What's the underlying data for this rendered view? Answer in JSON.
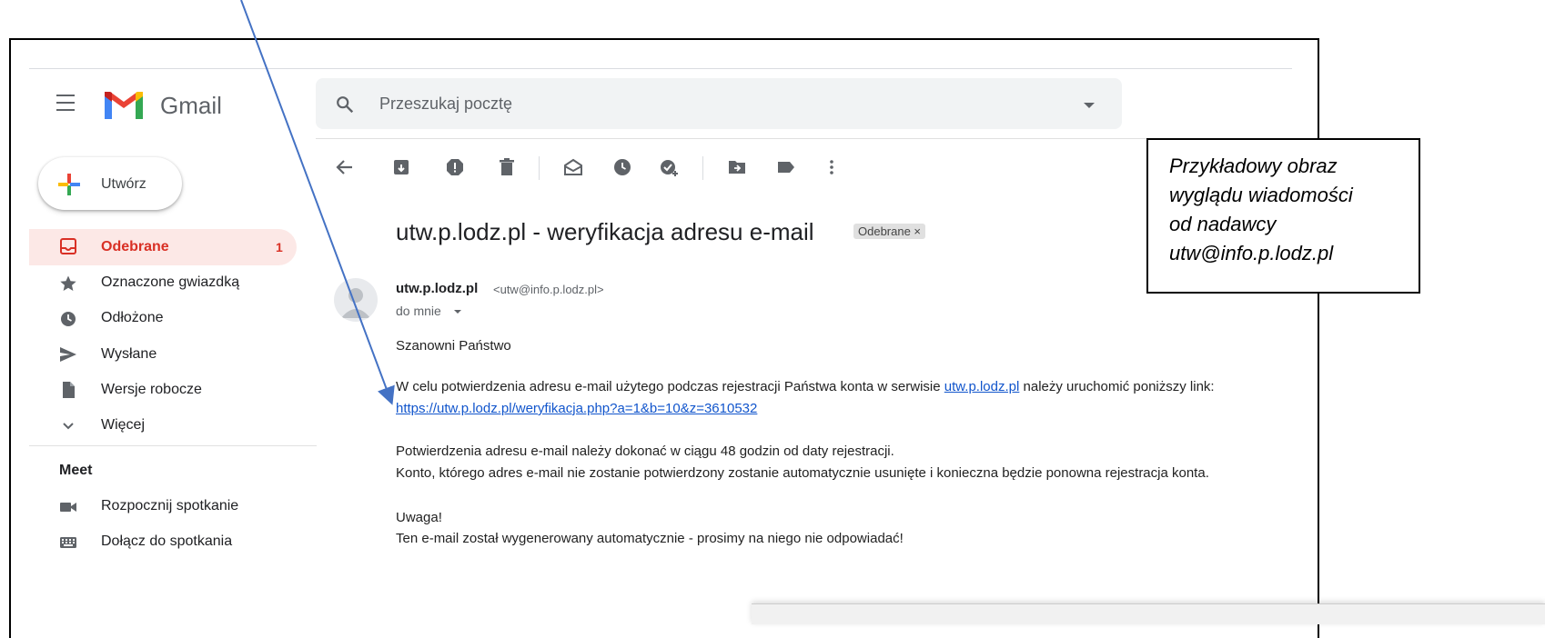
{
  "header": {
    "app_name": "Gmail",
    "search_placeholder": "Przeszukaj pocztę"
  },
  "compose": {
    "label": "Utwórz"
  },
  "sidebar": {
    "items": [
      {
        "label": "Odebrane",
        "count": "1",
        "icon": "inbox-icon"
      },
      {
        "label": "Oznaczone gwiazdką",
        "icon": "star-icon"
      },
      {
        "label": "Odłożone",
        "icon": "clock-icon"
      },
      {
        "label": "Wysłane",
        "icon": "send-icon"
      },
      {
        "label": "Wersje robocze",
        "icon": "draft-icon"
      },
      {
        "label": "Więcej",
        "icon": "chevron-down-icon"
      }
    ],
    "meet": {
      "title": "Meet",
      "items": [
        {
          "label": "Rozpocznij spotkanie",
          "icon": "video-icon"
        },
        {
          "label": "Dołącz do spotkania",
          "icon": "keyboard-icon"
        }
      ]
    }
  },
  "email": {
    "subject": "utw.p.lodz.pl - weryfikacja adresu e-mail",
    "label_chip": "Odebrane ×",
    "sender_name": "utw.p.lodz.pl",
    "sender_email": "<utw@info.p.lodz.pl>",
    "recipient": "do mnie",
    "greeting": "Szanowni Państwo",
    "para1_prefix": "W celu potwierdzenia adresu e-mail użytego podczas rejestracji Państwa konta w serwisie ",
    "para1_link": "utw.p.lodz.pl",
    "para1_suffix": " należy uruchomić poniższy link:",
    "verify_link": "https://utw.p.lodz.pl/weryfikacja.php?a=1&b=10&z=3610532",
    "para2": "Potwierdzenia adresu e-mail należy dokonać w ciągu 48 godzin od daty rejestracji.",
    "para3": "Konto, którego adres e-mail nie zostanie potwierdzony zostanie automatycznie usunięte i konieczna będzie ponowna rejestracja konta.",
    "warning_title": "Uwaga!",
    "warning_text": "Ten e-mail został wygenerowany automatycznie - prosimy na niego nie odpowiadać!"
  },
  "callout": {
    "line1": "Przykładowy obraz",
    "line2": "wyglądu wiadomości",
    "line3": "od nadawcy",
    "line4": "utw@info.p.lodz.pl"
  },
  "colors": {
    "accent_red": "#d93025",
    "link_blue": "#1155cc",
    "arrow_blue": "#4472c4"
  }
}
